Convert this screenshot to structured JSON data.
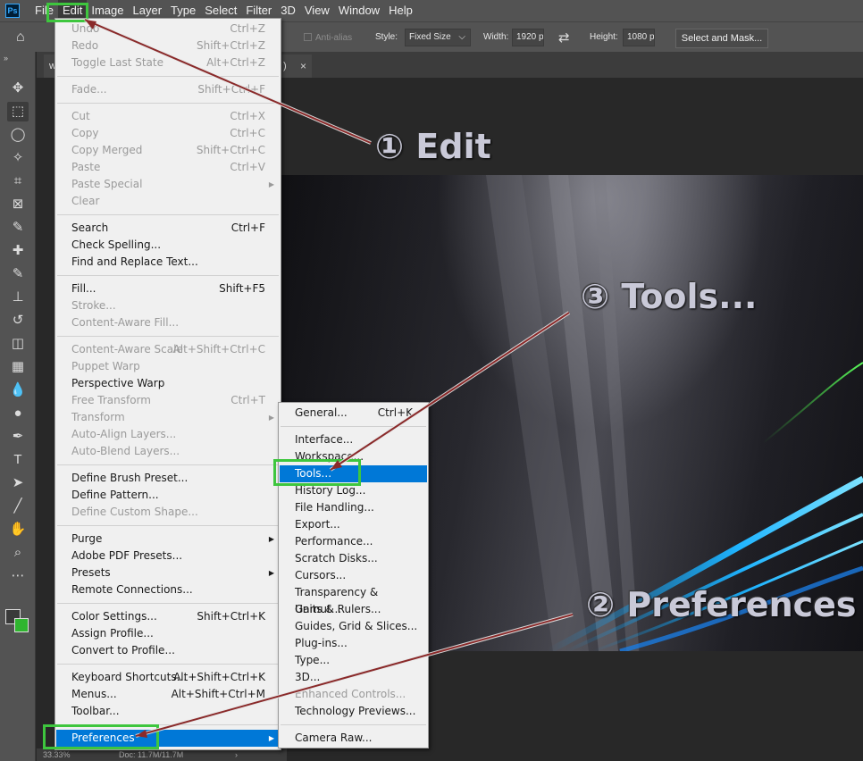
{
  "menubar": {
    "app_logo": "Ps",
    "items": [
      "File",
      "Edit",
      "Image",
      "Layer",
      "Type",
      "Select",
      "Filter",
      "3D",
      "View",
      "Window",
      "Help"
    ]
  },
  "options": {
    "antialias": "Anti-alias",
    "style_label": "Style:",
    "style_value": "Fixed Size",
    "width_label": "Width:",
    "width_value": "1920 px",
    "height_label": "Height:",
    "height_value": "1080 px",
    "select_mask": "Select and Mask..."
  },
  "document": {
    "tab_title": "w",
    "tab_suffix": ")",
    "close_glyph": "×",
    "zoom": "33.33%",
    "doc_size": "Doc: 11.7M/11.7M",
    "status_arrow": "›"
  },
  "edit_menu": {
    "items": [
      {
        "label": "Undo",
        "shortcut": "Ctrl+Z",
        "disabled": true
      },
      {
        "label": "Redo",
        "shortcut": "Shift+Ctrl+Z",
        "disabled": true
      },
      {
        "label": "Toggle Last State",
        "shortcut": "Alt+Ctrl+Z",
        "disabled": true
      },
      {
        "label": "Fade...",
        "shortcut": "Shift+Ctrl+F",
        "disabled": true
      },
      {
        "label": "Cut",
        "shortcut": "Ctrl+X",
        "disabled": true
      },
      {
        "label": "Copy",
        "shortcut": "Ctrl+C",
        "disabled": true
      },
      {
        "label": "Copy Merged",
        "shortcut": "Shift+Ctrl+C",
        "disabled": true
      },
      {
        "label": "Paste",
        "shortcut": "Ctrl+V",
        "disabled": true
      },
      {
        "label": "Paste Special",
        "shortcut": "",
        "disabled": true,
        "submenu": true
      },
      {
        "label": "Clear",
        "shortcut": "",
        "disabled": true
      },
      {
        "label": "Search",
        "shortcut": "Ctrl+F",
        "disabled": false
      },
      {
        "label": "Check Spelling...",
        "shortcut": "",
        "disabled": false
      },
      {
        "label": "Find and Replace Text...",
        "shortcut": "",
        "disabled": false
      },
      {
        "label": "Fill...",
        "shortcut": "Shift+F5",
        "disabled": false
      },
      {
        "label": "Stroke...",
        "shortcut": "",
        "disabled": true
      },
      {
        "label": "Content-Aware Fill...",
        "shortcut": "",
        "disabled": true
      },
      {
        "label": "Content-Aware Scale",
        "shortcut": "Alt+Shift+Ctrl+C",
        "disabled": true
      },
      {
        "label": "Puppet Warp",
        "shortcut": "",
        "disabled": true
      },
      {
        "label": "Perspective Warp",
        "shortcut": "",
        "disabled": false
      },
      {
        "label": "Free Transform",
        "shortcut": "Ctrl+T",
        "disabled": true
      },
      {
        "label": "Transform",
        "shortcut": "",
        "disabled": true,
        "submenu": true
      },
      {
        "label": "Auto-Align Layers...",
        "shortcut": "",
        "disabled": true
      },
      {
        "label": "Auto-Blend Layers...",
        "shortcut": "",
        "disabled": true
      },
      {
        "label": "Define Brush Preset...",
        "shortcut": "",
        "disabled": false
      },
      {
        "label": "Define Pattern...",
        "shortcut": "",
        "disabled": false
      },
      {
        "label": "Define Custom Shape...",
        "shortcut": "",
        "disabled": true
      },
      {
        "label": "Purge",
        "shortcut": "",
        "disabled": false,
        "submenu": true
      },
      {
        "label": "Adobe PDF Presets...",
        "shortcut": "",
        "disabled": false
      },
      {
        "label": "Presets",
        "shortcut": "",
        "disabled": false,
        "submenu": true
      },
      {
        "label": "Remote Connections...",
        "shortcut": "",
        "disabled": false
      },
      {
        "label": "Color Settings...",
        "shortcut": "Shift+Ctrl+K",
        "disabled": false
      },
      {
        "label": "Assign Profile...",
        "shortcut": "",
        "disabled": false
      },
      {
        "label": "Convert to Profile...",
        "shortcut": "",
        "disabled": false
      },
      {
        "label": "Keyboard Shortcuts...",
        "shortcut": "Alt+Shift+Ctrl+K",
        "disabled": false
      },
      {
        "label": "Menus...",
        "shortcut": "Alt+Shift+Ctrl+M",
        "disabled": false
      },
      {
        "label": "Toolbar...",
        "shortcut": "",
        "disabled": false
      },
      {
        "label": "Preferences",
        "shortcut": "",
        "disabled": false,
        "submenu": true,
        "highlighted": true
      }
    ]
  },
  "preferences_menu": {
    "items": [
      {
        "label": "General...",
        "shortcut": "Ctrl+K",
        "disabled": false
      },
      {
        "label": "Interface...",
        "shortcut": "",
        "disabled": false
      },
      {
        "label": "Workspace...",
        "shortcut": "",
        "disabled": false
      },
      {
        "label": "Tools...",
        "shortcut": "",
        "disabled": false,
        "highlighted": true
      },
      {
        "label": "History Log...",
        "shortcut": "",
        "disabled": false
      },
      {
        "label": "File Handling...",
        "shortcut": "",
        "disabled": false
      },
      {
        "label": "Export...",
        "shortcut": "",
        "disabled": false
      },
      {
        "label": "Performance...",
        "shortcut": "",
        "disabled": false
      },
      {
        "label": "Scratch Disks...",
        "shortcut": "",
        "disabled": false
      },
      {
        "label": "Cursors...",
        "shortcut": "",
        "disabled": false
      },
      {
        "label": "Transparency & Gamut...",
        "shortcut": "",
        "disabled": false
      },
      {
        "label": "Units & Rulers...",
        "shortcut": "",
        "disabled": false
      },
      {
        "label": "Guides, Grid & Slices...",
        "shortcut": "",
        "disabled": false
      },
      {
        "label": "Plug-ins...",
        "shortcut": "",
        "disabled": false
      },
      {
        "label": "Type...",
        "shortcut": "",
        "disabled": false
      },
      {
        "label": "3D...",
        "shortcut": "",
        "disabled": false
      },
      {
        "label": "Enhanced Controls...",
        "shortcut": "",
        "disabled": true
      },
      {
        "label": "Technology Previews...",
        "shortcut": "",
        "disabled": false
      },
      {
        "label": "Camera Raw...",
        "shortcut": "",
        "disabled": false
      }
    ]
  },
  "annotations": {
    "step1": "① Edit",
    "step2": "② Preferences",
    "step3": "③ Tools..."
  },
  "colors": {
    "highlight": "#0078d7",
    "annotation_box": "#3ec63e",
    "arrow": "#8a2a2a"
  },
  "tools": [
    "move-tool-icon",
    "marquee-tool-icon",
    "lasso-tool-icon",
    "magic-wand-icon",
    "crop-tool-icon",
    "frame-tool-icon",
    "eyedropper-icon",
    "healing-brush-icon",
    "brush-tool-icon",
    "clone-stamp-icon",
    "history-brush-icon",
    "eraser-icon",
    "gradient-tool-icon",
    "blur-tool-icon",
    "dodge-tool-icon",
    "pen-tool-icon",
    "type-tool-icon",
    "path-select-icon",
    "line-tool-icon",
    "hand-tool-icon",
    "zoom-tool-icon",
    "more-tools-icon"
  ]
}
